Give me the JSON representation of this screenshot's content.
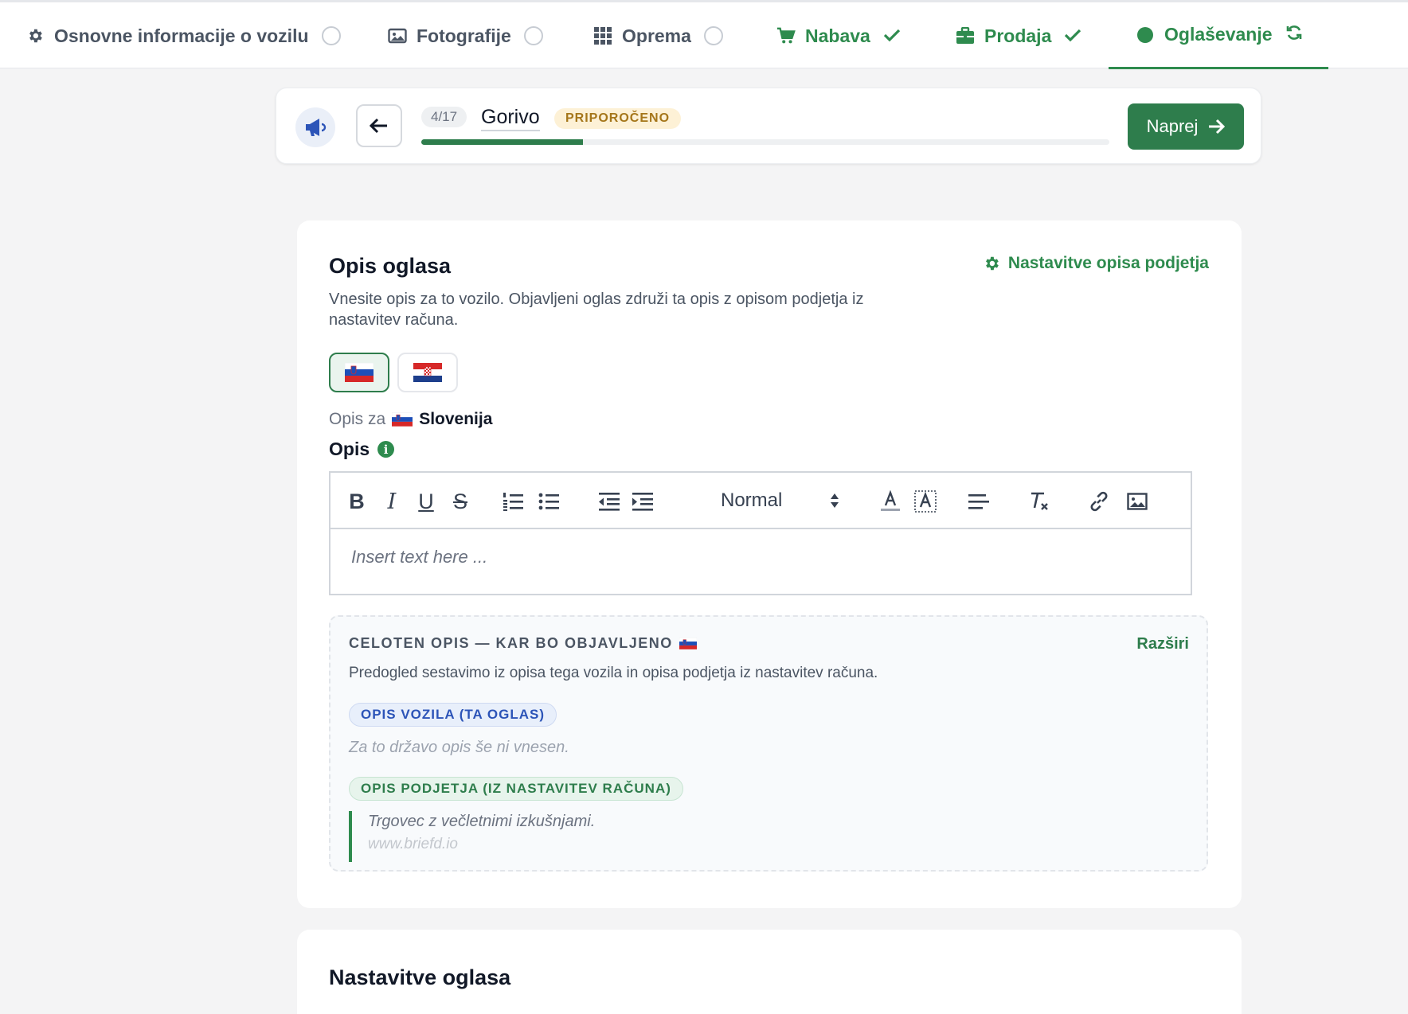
{
  "tabs": [
    {
      "label": "Osnovne informacije o vozilu",
      "icon": "gear-icon",
      "status": "empty"
    },
    {
      "label": "Fotografije",
      "icon": "image-icon",
      "status": "empty"
    },
    {
      "label": "Oprema",
      "icon": "grid-icon",
      "status": "empty"
    },
    {
      "label": "Nabava",
      "icon": "cart-icon",
      "status": "done"
    },
    {
      "label": "Prodaja",
      "icon": "briefcase-icon",
      "status": "done"
    },
    {
      "label": "Oglaševanje",
      "icon": "circle-icon",
      "status": "active"
    }
  ],
  "stepper": {
    "count": "4/17",
    "title": "Gorivo",
    "badge": "PRIPOROČENO",
    "progress_fraction": 0.235,
    "next_label": "Naprej"
  },
  "description": {
    "title": "Opis oglasa",
    "settings_link": "Nastavitve opisa podjetja",
    "text": "Vnesite opis za to vozilo. Objavljeni oglas združi ta opis z opisom podjetja iz nastavitev računa.",
    "languages": [
      "Slovenija",
      "Hrvatska"
    ],
    "for_prefix": "Opis za",
    "for_country": "Slovenija",
    "field_label": "Opis",
    "editor_format": "Normal",
    "editor_placeholder": "Insert text here ..."
  },
  "preview": {
    "title": "CELOTEN OPIS — KAR BO OBJAVLJENO",
    "expand_label": "Razširi",
    "text": "Predogled sestavimo iz opisa tega vozila in opisa podjetja iz nastavitev računa.",
    "vehicle_pill": "OPIS VOZILA (TA OGLAS)",
    "vehicle_empty": "Za to državo opis še ni vnesen.",
    "company_pill": "OPIS PODJETJA (IZ NASTAVITEV RAČUNA)",
    "company_text": "Trgovec z večletnimi izkušnjami.",
    "company_url": "www.briefd.io"
  },
  "settings_card": {
    "title": "Nastavitve oglasa"
  },
  "colors": {
    "accent": "#2e7d4c",
    "accent_text": "#2e8b4e",
    "badge_bg": "#fdf1d6",
    "badge_text": "#a5761a",
    "pill_blue": "#2c54b8"
  }
}
